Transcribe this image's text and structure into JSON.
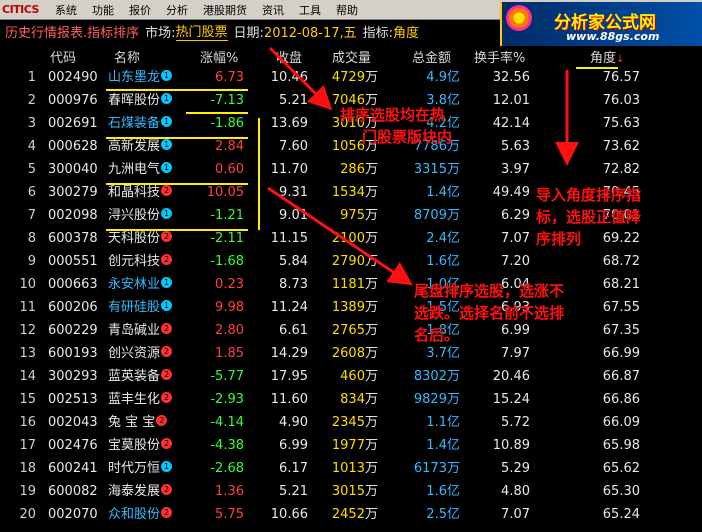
{
  "menu": {
    "logo": "CITICS",
    "items": [
      "系统",
      "功能",
      "报价",
      "分析",
      "港股期货",
      "资讯",
      "工具",
      "帮助"
    ]
  },
  "info": {
    "title": "历史行情报表.指标排序",
    "market_label": "市场:",
    "market_value": "热门股票",
    "date_label": "日期:",
    "date_value": "2012-08-17,五",
    "indicator_label": "指标:",
    "indicator_value": "角度"
  },
  "promo": {
    "brand": "分析家公式网",
    "url": "www.88gs.com"
  },
  "columns": {
    "code": "代码",
    "name": "名称",
    "pct": "涨幅%",
    "close": "收盘",
    "vol": "成交量",
    "cap": "总金额",
    "turn": "换手率%",
    "ang": "角度"
  },
  "units": {
    "wan": "万",
    "yi": "亿"
  },
  "rows": [
    {
      "idx": "1",
      "code": "002490",
      "name": "山东墨龙",
      "badge": "1",
      "blue": true,
      "pct": "6.73",
      "dir": "up",
      "close": "10.46",
      "vol": "4729",
      "cap": "4.9",
      "cap_unit": "亿",
      "turn": "32.56",
      "ang": "76.57"
    },
    {
      "idx": "2",
      "code": "000976",
      "name": "春晖股份",
      "badge": "1",
      "blue": false,
      "pct": "-7.13",
      "dir": "dn",
      "close": "5.21",
      "vol": "7046",
      "cap": "3.8",
      "cap_unit": "亿",
      "turn": "12.01",
      "ang": "76.03"
    },
    {
      "idx": "3",
      "code": "002691",
      "name": "石煤装备",
      "badge": "1",
      "blue": true,
      "pct": "-1.86",
      "dir": "dn",
      "close": "13.69",
      "vol": "3010",
      "cap": "4.2",
      "cap_unit": "亿",
      "turn": "42.14",
      "ang": "75.63"
    },
    {
      "idx": "4",
      "code": "000628",
      "name": "高新发展",
      "badge": "1",
      "blue": false,
      "pct": "2.84",
      "dir": "up",
      "close": "7.60",
      "vol": "1056",
      "cap": "7786",
      "cap_unit": "万",
      "turn": "5.63",
      "ang": "73.62"
    },
    {
      "idx": "5",
      "code": "300040",
      "name": "九洲电气",
      "badge": "1",
      "blue": false,
      "pct": "0.60",
      "dir": "up",
      "close": "11.70",
      "vol": "286",
      "cap": "3315",
      "cap_unit": "万",
      "turn": "3.97",
      "ang": "72.82"
    },
    {
      "idx": "6",
      "code": "300279",
      "name": "和晶科技",
      "badge": "2",
      "blue": false,
      "pct": "10.05",
      "dir": "up",
      "close": "9.31",
      "vol": "1534",
      "cap": "1.4",
      "cap_unit": "亿",
      "turn": "49.49",
      "ang": "70.45"
    },
    {
      "idx": "7",
      "code": "002098",
      "name": "浔兴股份",
      "badge": "1",
      "blue": false,
      "pct": "-1.21",
      "dir": "dn",
      "close": "9.01",
      "vol": "975",
      "cap": "8709",
      "cap_unit": "万",
      "turn": "6.29",
      "ang": "70.01"
    },
    {
      "idx": "8",
      "code": "600378",
      "name": "天科股份",
      "badge": "2",
      "blue": false,
      "pct": "-2.11",
      "dir": "dn",
      "close": "11.15",
      "vol": "2100",
      "cap": "2.4",
      "cap_unit": "亿",
      "turn": "7.07",
      "ang": "69.22"
    },
    {
      "idx": "9",
      "code": "000551",
      "name": "创元科技",
      "badge": "2",
      "blue": false,
      "pct": "-1.68",
      "dir": "dn",
      "close": "5.84",
      "vol": "2790",
      "cap": "1.6",
      "cap_unit": "亿",
      "turn": "7.20",
      "ang": "68.72"
    },
    {
      "idx": "10",
      "code": "000663",
      "name": "永安林业",
      "badge": "1",
      "blue": true,
      "pct": "0.23",
      "dir": "up",
      "close": "8.73",
      "vol": "1181",
      "cap": "1.0",
      "cap_unit": "亿",
      "turn": "6.04",
      "ang": "68.21"
    },
    {
      "idx": "11",
      "code": "600206",
      "name": "有研硅股",
      "badge": "1",
      "blue": true,
      "pct": "9.98",
      "dir": "up",
      "close": "11.24",
      "vol": "1389",
      "cap": "1.5",
      "cap_unit": "亿",
      "turn": "6.93",
      "ang": "67.55"
    },
    {
      "idx": "12",
      "code": "600229",
      "name": "青岛碱业",
      "badge": "2",
      "blue": false,
      "pct": "2.80",
      "dir": "up",
      "close": "6.61",
      "vol": "2765",
      "cap": "1.8",
      "cap_unit": "亿",
      "turn": "6.99",
      "ang": "67.35"
    },
    {
      "idx": "13",
      "code": "600193",
      "name": "创兴资源",
      "badge": "2",
      "blue": false,
      "pct": "1.85",
      "dir": "up",
      "close": "14.29",
      "vol": "2608",
      "cap": "3.7",
      "cap_unit": "亿",
      "turn": "7.97",
      "ang": "66.99"
    },
    {
      "idx": "14",
      "code": "300293",
      "name": "蓝英装备",
      "badge": "2",
      "blue": false,
      "pct": "-5.77",
      "dir": "dn",
      "close": "17.95",
      "vol": "460",
      "cap": "8302",
      "cap_unit": "万",
      "turn": "20.46",
      "ang": "66.87"
    },
    {
      "idx": "15",
      "code": "002513",
      "name": "蓝丰生化",
      "badge": "2",
      "blue": false,
      "pct": "-2.93",
      "dir": "dn",
      "close": "11.60",
      "vol": "834",
      "cap": "9829",
      "cap_unit": "万",
      "turn": "15.24",
      "ang": "66.86"
    },
    {
      "idx": "16",
      "code": "002043",
      "name": "兔 宝 宝",
      "badge": "2",
      "blue": false,
      "pct": "-4.14",
      "dir": "dn",
      "close": "4.90",
      "vol": "2345",
      "cap": "1.1",
      "cap_unit": "亿",
      "turn": "5.72",
      "ang": "66.09"
    },
    {
      "idx": "17",
      "code": "002476",
      "name": "宝莫股份",
      "badge": "2",
      "blue": false,
      "pct": "-4.38",
      "dir": "dn",
      "close": "6.99",
      "vol": "1977",
      "cap": "1.4",
      "cap_unit": "亿",
      "turn": "10.89",
      "ang": "65.98"
    },
    {
      "idx": "18",
      "code": "600241",
      "name": "时代万恒",
      "badge": "1",
      "blue": false,
      "pct": "-2.68",
      "dir": "dn",
      "close": "6.17",
      "vol": "1013",
      "cap": "6173",
      "cap_unit": "万",
      "turn": "5.29",
      "ang": "65.62"
    },
    {
      "idx": "19",
      "code": "600082",
      "name": "海泰发展",
      "badge": "2",
      "blue": false,
      "pct": "1.36",
      "dir": "up",
      "close": "5.21",
      "vol": "3015",
      "cap": "1.6",
      "cap_unit": "亿",
      "turn": "4.80",
      "ang": "65.30"
    },
    {
      "idx": "20",
      "code": "002070",
      "name": "众和股份",
      "badge": "2",
      "blue": true,
      "pct": "5.75",
      "dir": "up",
      "close": "10.66",
      "vol": "2452",
      "cap": "2.5",
      "cap_unit": "亿",
      "turn": "7.07",
      "ang": "65.24"
    }
  ],
  "annotations": {
    "a1": [
      "排序选股均在热",
      "门股票版块内"
    ],
    "a2": [
      "导入角度排序指",
      "标，选股正值降",
      "序排列"
    ],
    "a3": [
      "尾盘排序选股，选涨不",
      "选跌。选择名前不选排",
      "名后。"
    ]
  },
  "colors": {
    "up": "#ff4040",
    "down": "#33ff33",
    "annotation": "#ff1010",
    "highlight": "#ffee00"
  }
}
